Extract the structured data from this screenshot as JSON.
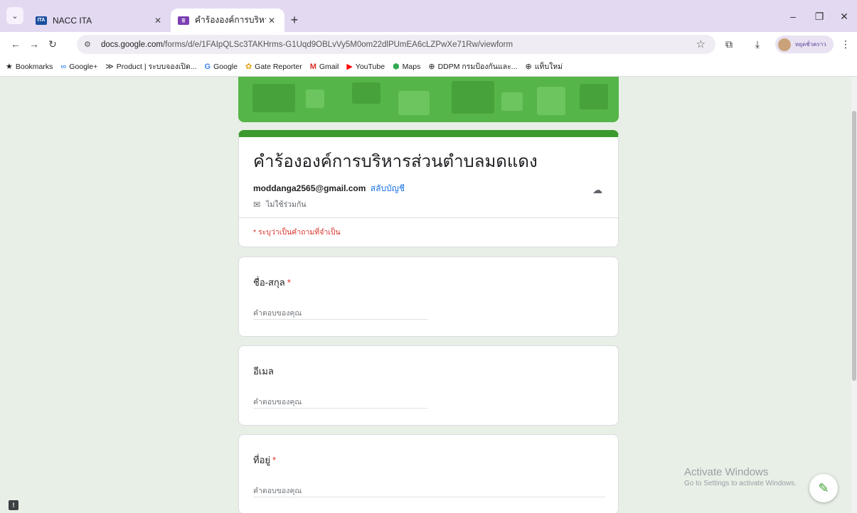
{
  "browser": {
    "tabs": [
      {
        "title": "NACC ITA",
        "favicon": "ITA",
        "active": false
      },
      {
        "title": "คำร้ององค์การบริหารส่วนตำบลมดแดง",
        "favicon": "form-icon",
        "active": true
      }
    ],
    "url_host": "docs.google.com",
    "url_path": "/forms/d/e/1FAIpQLSc3TAKHrms-G1Uqd9OBLvVy5M0om22dlPUmEA6cLZPwXe71Rw/viewform",
    "profile_name": "หยุดชั่วคราว",
    "bookmarks": [
      {
        "label": "Bookmarks",
        "icon": "★"
      },
      {
        "label": "Google+",
        "icon": "∞"
      },
      {
        "label": "Product | ระบบจองเปิด...",
        "icon": "≫"
      },
      {
        "label": "Google",
        "icon": "G"
      },
      {
        "label": "Gate Reporter",
        "icon": "✿"
      },
      {
        "label": "Gmail",
        "icon": "M"
      },
      {
        "label": "YouTube",
        "icon": "▶"
      },
      {
        "label": "Maps",
        "icon": "⬢"
      },
      {
        "label": "DDPM กรมป้องกันและ...",
        "icon": "⊕"
      },
      {
        "label": "แท็บใหม่",
        "icon": "⊕"
      }
    ]
  },
  "form": {
    "title": "คำร้ององค์การบริหารส่วนตำบลมดแดง",
    "account_email": "moddanga2565@gmail.com",
    "switch_account": "สลับบัญชี",
    "not_shared": "ไม่ใช้ร่วมกัน",
    "required_note": "* ระบุว่าเป็นคำถามที่จำเป็น",
    "questions": [
      {
        "label": "ชื่อ-สกุล",
        "required": "*",
        "placeholder": "คำตอบของคุณ"
      },
      {
        "label": "อีเมล",
        "required": "",
        "placeholder": "คำตอบของคุณ"
      },
      {
        "label": "ที่อยู่",
        "required": "*",
        "placeholder": "คำตอบของคุณ"
      }
    ]
  },
  "watermark": {
    "line1": "Activate Windows",
    "line2": "Go to Settings to activate Windows."
  },
  "colors": {
    "theme_green": "#3b9a2e",
    "banner_green": "#56b548",
    "background": "#e8efe6",
    "required_red": "#d93025"
  }
}
